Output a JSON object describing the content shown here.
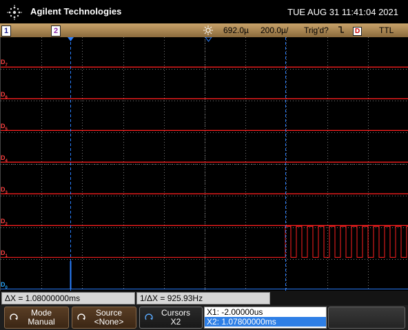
{
  "header": {
    "brand": "Agilent Technologies",
    "datetime": "TUE AUG 31 11:41:04 2021",
    "logo_icon": "agilent-spark-icon"
  },
  "status_bar": {
    "channel1": "1",
    "channel2": "2",
    "brightness_icon": "sun-icon",
    "position": "692.0µ",
    "timebase": "200.0µ/",
    "trigger_status": "Trig'd?",
    "trigger_edge_icon": "falling-edge-icon",
    "trigger_source": "D",
    "logic_level": "TTL"
  },
  "screen": {
    "grid_color": "#7a7a7a",
    "trace_color": "#ff2020",
    "cursor_color": "#2a7fff",
    "digital_channels": [
      "D7",
      "D6",
      "D5",
      "D4",
      "D3",
      "D2",
      "D1",
      "D0"
    ],
    "labels": {
      "d7": {
        "main": "D",
        "sub": "7"
      },
      "d6": {
        "main": "D",
        "sub": "6"
      },
      "d5": {
        "main": "D",
        "sub": "5"
      },
      "d4": {
        "main": "D",
        "sub": "4"
      },
      "d3": {
        "main": "D",
        "sub": "3"
      },
      "d2": {
        "main": "D",
        "sub": "2"
      },
      "d1": {
        "main": "D",
        "sub": "1"
      },
      "d0": {
        "main": "D",
        "sub": "0"
      }
    }
  },
  "measurements": {
    "delta_x": "ΔX = 1.08000000ms",
    "inv_delta_x": "1/ΔX = 925.93Hz"
  },
  "softkeys": {
    "mode_label": "Mode",
    "mode_value": "Manual",
    "source_label": "Source",
    "source_value": "<None>",
    "cursors_label": "Cursors",
    "cursors_value": "X2",
    "x1": "X1: -2.00000us",
    "x2": "X2: 1.07800000ms"
  }
}
